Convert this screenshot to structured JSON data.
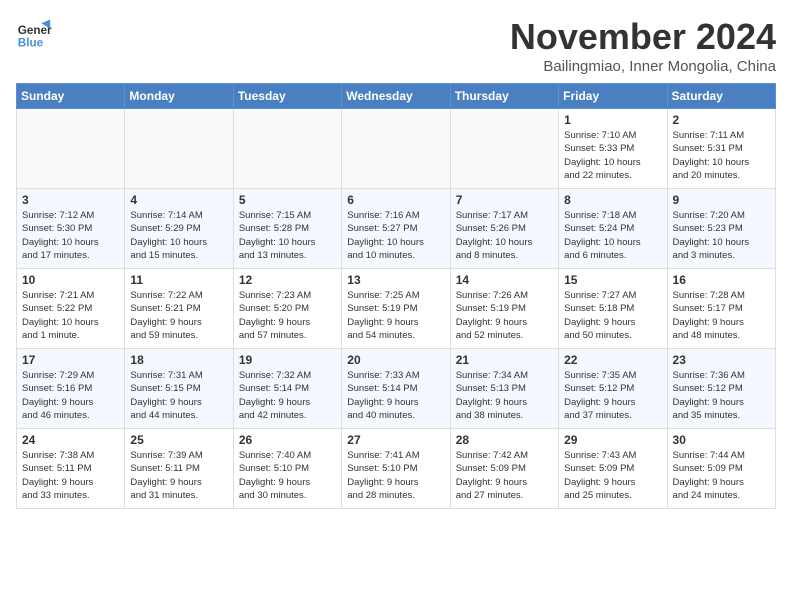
{
  "header": {
    "logo_line1": "General",
    "logo_line2": "Blue",
    "month_title": "November 2024",
    "location": "Bailingmiao, Inner Mongolia, China"
  },
  "weekdays": [
    "Sunday",
    "Monday",
    "Tuesday",
    "Wednesday",
    "Thursday",
    "Friday",
    "Saturday"
  ],
  "weeks": [
    [
      {
        "day": "",
        "info": ""
      },
      {
        "day": "",
        "info": ""
      },
      {
        "day": "",
        "info": ""
      },
      {
        "day": "",
        "info": ""
      },
      {
        "day": "",
        "info": ""
      },
      {
        "day": "1",
        "info": "Sunrise: 7:10 AM\nSunset: 5:33 PM\nDaylight: 10 hours\nand 22 minutes."
      },
      {
        "day": "2",
        "info": "Sunrise: 7:11 AM\nSunset: 5:31 PM\nDaylight: 10 hours\nand 20 minutes."
      }
    ],
    [
      {
        "day": "3",
        "info": "Sunrise: 7:12 AM\nSunset: 5:30 PM\nDaylight: 10 hours\nand 17 minutes."
      },
      {
        "day": "4",
        "info": "Sunrise: 7:14 AM\nSunset: 5:29 PM\nDaylight: 10 hours\nand 15 minutes."
      },
      {
        "day": "5",
        "info": "Sunrise: 7:15 AM\nSunset: 5:28 PM\nDaylight: 10 hours\nand 13 minutes."
      },
      {
        "day": "6",
        "info": "Sunrise: 7:16 AM\nSunset: 5:27 PM\nDaylight: 10 hours\nand 10 minutes."
      },
      {
        "day": "7",
        "info": "Sunrise: 7:17 AM\nSunset: 5:26 PM\nDaylight: 10 hours\nand 8 minutes."
      },
      {
        "day": "8",
        "info": "Sunrise: 7:18 AM\nSunset: 5:24 PM\nDaylight: 10 hours\nand 6 minutes."
      },
      {
        "day": "9",
        "info": "Sunrise: 7:20 AM\nSunset: 5:23 PM\nDaylight: 10 hours\nand 3 minutes."
      }
    ],
    [
      {
        "day": "10",
        "info": "Sunrise: 7:21 AM\nSunset: 5:22 PM\nDaylight: 10 hours\nand 1 minute."
      },
      {
        "day": "11",
        "info": "Sunrise: 7:22 AM\nSunset: 5:21 PM\nDaylight: 9 hours\nand 59 minutes."
      },
      {
        "day": "12",
        "info": "Sunrise: 7:23 AM\nSunset: 5:20 PM\nDaylight: 9 hours\nand 57 minutes."
      },
      {
        "day": "13",
        "info": "Sunrise: 7:25 AM\nSunset: 5:19 PM\nDaylight: 9 hours\nand 54 minutes."
      },
      {
        "day": "14",
        "info": "Sunrise: 7:26 AM\nSunset: 5:19 PM\nDaylight: 9 hours\nand 52 minutes."
      },
      {
        "day": "15",
        "info": "Sunrise: 7:27 AM\nSunset: 5:18 PM\nDaylight: 9 hours\nand 50 minutes."
      },
      {
        "day": "16",
        "info": "Sunrise: 7:28 AM\nSunset: 5:17 PM\nDaylight: 9 hours\nand 48 minutes."
      }
    ],
    [
      {
        "day": "17",
        "info": "Sunrise: 7:29 AM\nSunset: 5:16 PM\nDaylight: 9 hours\nand 46 minutes."
      },
      {
        "day": "18",
        "info": "Sunrise: 7:31 AM\nSunset: 5:15 PM\nDaylight: 9 hours\nand 44 minutes."
      },
      {
        "day": "19",
        "info": "Sunrise: 7:32 AM\nSunset: 5:14 PM\nDaylight: 9 hours\nand 42 minutes."
      },
      {
        "day": "20",
        "info": "Sunrise: 7:33 AM\nSunset: 5:14 PM\nDaylight: 9 hours\nand 40 minutes."
      },
      {
        "day": "21",
        "info": "Sunrise: 7:34 AM\nSunset: 5:13 PM\nDaylight: 9 hours\nand 38 minutes."
      },
      {
        "day": "22",
        "info": "Sunrise: 7:35 AM\nSunset: 5:12 PM\nDaylight: 9 hours\nand 37 minutes."
      },
      {
        "day": "23",
        "info": "Sunrise: 7:36 AM\nSunset: 5:12 PM\nDaylight: 9 hours\nand 35 minutes."
      }
    ],
    [
      {
        "day": "24",
        "info": "Sunrise: 7:38 AM\nSunset: 5:11 PM\nDaylight: 9 hours\nand 33 minutes."
      },
      {
        "day": "25",
        "info": "Sunrise: 7:39 AM\nSunset: 5:11 PM\nDaylight: 9 hours\nand 31 minutes."
      },
      {
        "day": "26",
        "info": "Sunrise: 7:40 AM\nSunset: 5:10 PM\nDaylight: 9 hours\nand 30 minutes."
      },
      {
        "day": "27",
        "info": "Sunrise: 7:41 AM\nSunset: 5:10 PM\nDaylight: 9 hours\nand 28 minutes."
      },
      {
        "day": "28",
        "info": "Sunrise: 7:42 AM\nSunset: 5:09 PM\nDaylight: 9 hours\nand 27 minutes."
      },
      {
        "day": "29",
        "info": "Sunrise: 7:43 AM\nSunset: 5:09 PM\nDaylight: 9 hours\nand 25 minutes."
      },
      {
        "day": "30",
        "info": "Sunrise: 7:44 AM\nSunset: 5:09 PM\nDaylight: 9 hours\nand 24 minutes."
      }
    ]
  ]
}
